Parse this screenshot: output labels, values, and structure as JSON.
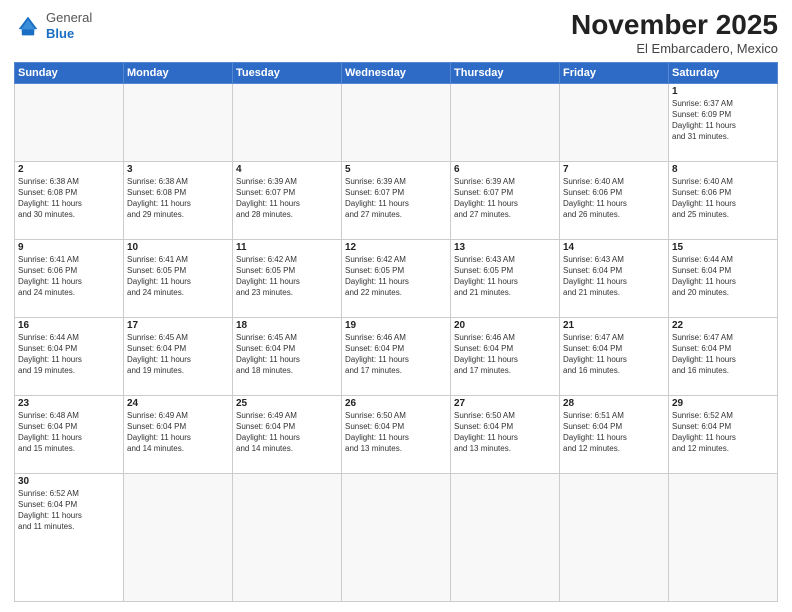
{
  "header": {
    "logo_general": "General",
    "logo_blue": "Blue",
    "month": "November 2025",
    "location": "El Embarcadero, Mexico"
  },
  "weekdays": [
    "Sunday",
    "Monday",
    "Tuesday",
    "Wednesday",
    "Thursday",
    "Friday",
    "Saturday"
  ],
  "weeks": [
    [
      {
        "day": "",
        "info": ""
      },
      {
        "day": "",
        "info": ""
      },
      {
        "day": "",
        "info": ""
      },
      {
        "day": "",
        "info": ""
      },
      {
        "day": "",
        "info": ""
      },
      {
        "day": "",
        "info": ""
      },
      {
        "day": "1",
        "info": "Sunrise: 6:37 AM\nSunset: 6:09 PM\nDaylight: 11 hours\nand 31 minutes."
      }
    ],
    [
      {
        "day": "2",
        "info": "Sunrise: 6:38 AM\nSunset: 6:08 PM\nDaylight: 11 hours\nand 30 minutes."
      },
      {
        "day": "3",
        "info": "Sunrise: 6:38 AM\nSunset: 6:08 PM\nDaylight: 11 hours\nand 29 minutes."
      },
      {
        "day": "4",
        "info": "Sunrise: 6:39 AM\nSunset: 6:07 PM\nDaylight: 11 hours\nand 28 minutes."
      },
      {
        "day": "5",
        "info": "Sunrise: 6:39 AM\nSunset: 6:07 PM\nDaylight: 11 hours\nand 27 minutes."
      },
      {
        "day": "6",
        "info": "Sunrise: 6:39 AM\nSunset: 6:07 PM\nDaylight: 11 hours\nand 27 minutes."
      },
      {
        "day": "7",
        "info": "Sunrise: 6:40 AM\nSunset: 6:06 PM\nDaylight: 11 hours\nand 26 minutes."
      },
      {
        "day": "8",
        "info": "Sunrise: 6:40 AM\nSunset: 6:06 PM\nDaylight: 11 hours\nand 25 minutes."
      }
    ],
    [
      {
        "day": "9",
        "info": "Sunrise: 6:41 AM\nSunset: 6:06 PM\nDaylight: 11 hours\nand 24 minutes."
      },
      {
        "day": "10",
        "info": "Sunrise: 6:41 AM\nSunset: 6:05 PM\nDaylight: 11 hours\nand 24 minutes."
      },
      {
        "day": "11",
        "info": "Sunrise: 6:42 AM\nSunset: 6:05 PM\nDaylight: 11 hours\nand 23 minutes."
      },
      {
        "day": "12",
        "info": "Sunrise: 6:42 AM\nSunset: 6:05 PM\nDaylight: 11 hours\nand 22 minutes."
      },
      {
        "day": "13",
        "info": "Sunrise: 6:43 AM\nSunset: 6:05 PM\nDaylight: 11 hours\nand 21 minutes."
      },
      {
        "day": "14",
        "info": "Sunrise: 6:43 AM\nSunset: 6:04 PM\nDaylight: 11 hours\nand 21 minutes."
      },
      {
        "day": "15",
        "info": "Sunrise: 6:44 AM\nSunset: 6:04 PM\nDaylight: 11 hours\nand 20 minutes."
      }
    ],
    [
      {
        "day": "16",
        "info": "Sunrise: 6:44 AM\nSunset: 6:04 PM\nDaylight: 11 hours\nand 19 minutes."
      },
      {
        "day": "17",
        "info": "Sunrise: 6:45 AM\nSunset: 6:04 PM\nDaylight: 11 hours\nand 19 minutes."
      },
      {
        "day": "18",
        "info": "Sunrise: 6:45 AM\nSunset: 6:04 PM\nDaylight: 11 hours\nand 18 minutes."
      },
      {
        "day": "19",
        "info": "Sunrise: 6:46 AM\nSunset: 6:04 PM\nDaylight: 11 hours\nand 17 minutes."
      },
      {
        "day": "20",
        "info": "Sunrise: 6:46 AM\nSunset: 6:04 PM\nDaylight: 11 hours\nand 17 minutes."
      },
      {
        "day": "21",
        "info": "Sunrise: 6:47 AM\nSunset: 6:04 PM\nDaylight: 11 hours\nand 16 minutes."
      },
      {
        "day": "22",
        "info": "Sunrise: 6:47 AM\nSunset: 6:04 PM\nDaylight: 11 hours\nand 16 minutes."
      }
    ],
    [
      {
        "day": "23",
        "info": "Sunrise: 6:48 AM\nSunset: 6:04 PM\nDaylight: 11 hours\nand 15 minutes."
      },
      {
        "day": "24",
        "info": "Sunrise: 6:49 AM\nSunset: 6:04 PM\nDaylight: 11 hours\nand 14 minutes."
      },
      {
        "day": "25",
        "info": "Sunrise: 6:49 AM\nSunset: 6:04 PM\nDaylight: 11 hours\nand 14 minutes."
      },
      {
        "day": "26",
        "info": "Sunrise: 6:50 AM\nSunset: 6:04 PM\nDaylight: 11 hours\nand 13 minutes."
      },
      {
        "day": "27",
        "info": "Sunrise: 6:50 AM\nSunset: 6:04 PM\nDaylight: 11 hours\nand 13 minutes."
      },
      {
        "day": "28",
        "info": "Sunrise: 6:51 AM\nSunset: 6:04 PM\nDaylight: 11 hours\nand 12 minutes."
      },
      {
        "day": "29",
        "info": "Sunrise: 6:52 AM\nSunset: 6:04 PM\nDaylight: 11 hours\nand 12 minutes."
      }
    ],
    [
      {
        "day": "30",
        "info": "Sunrise: 6:52 AM\nSunset: 6:04 PM\nDaylight: 11 hours\nand 11 minutes."
      },
      {
        "day": "",
        "info": ""
      },
      {
        "day": "",
        "info": ""
      },
      {
        "day": "",
        "info": ""
      },
      {
        "day": "",
        "info": ""
      },
      {
        "day": "",
        "info": ""
      },
      {
        "day": "",
        "info": ""
      }
    ]
  ]
}
